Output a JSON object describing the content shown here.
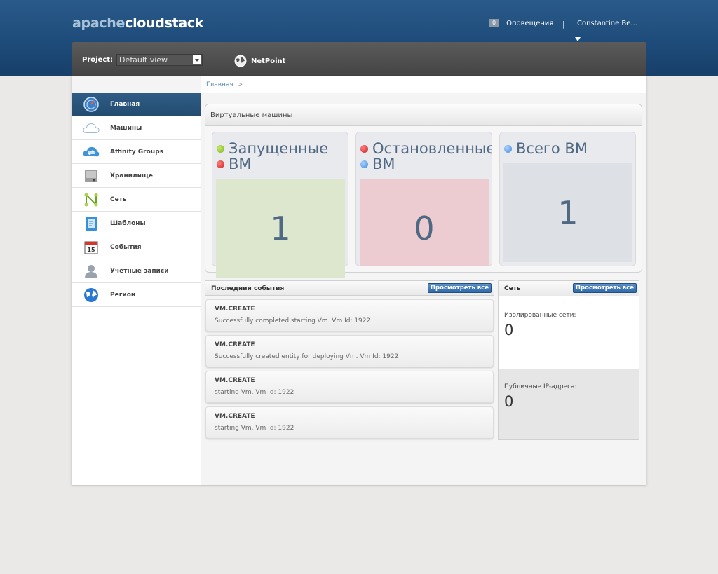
{
  "header": {
    "logo_part1": "apache",
    "logo_part2": "cloudstack",
    "notifications_count": "0",
    "notifications_label": "Оповещения",
    "divider": "|",
    "username": "Constantine Be..."
  },
  "project": {
    "label": "Project:",
    "selected": "Default view",
    "domain_name": "NetPoint"
  },
  "breadcrumb": {
    "home": "Главная",
    "separator": ">"
  },
  "sidebar": {
    "items": [
      {
        "label": "Главная",
        "icon": "dashboard-icon",
        "active": true
      },
      {
        "label": "Машины",
        "icon": "cloud-icon"
      },
      {
        "label": "Affinity Groups",
        "icon": "affinity-icon"
      },
      {
        "label": "Хранилище",
        "icon": "storage-icon"
      },
      {
        "label": "Сеть",
        "icon": "network-icon"
      },
      {
        "label": "Шаблоны",
        "icon": "templates-icon"
      },
      {
        "label": "События",
        "icon": "calendar-icon",
        "icon_text": "15"
      },
      {
        "label": "Учётные записи",
        "icon": "user-icon"
      },
      {
        "label": "Регион",
        "icon": "globe-icon"
      }
    ]
  },
  "vm_panel": {
    "title": "Виртуальные машины",
    "running": {
      "line1": "Запущенные",
      "line2": "ВМ",
      "value": "1"
    },
    "stopped": {
      "line1": "Остановленные",
      "line2": "ВМ",
      "value": "0"
    },
    "total": {
      "line1": "Всего ВМ",
      "value": "1"
    }
  },
  "events_panel": {
    "title": "Последнии события",
    "view_all": "Просмотреть всё",
    "events": [
      {
        "title": "VM.CREATE",
        "desc": "Successfully completed starting Vm. Vm Id: 1922"
      },
      {
        "title": "VM.CREATE",
        "desc": "Successfully created entity for deploying Vm. Vm Id: 1922"
      },
      {
        "title": "VM.CREATE",
        "desc": "starting Vm. Vm Id: 1922"
      },
      {
        "title": "VM.CREATE",
        "desc": "starting Vm. Vm Id: 1922"
      }
    ]
  },
  "network_panel": {
    "title": "Сеть",
    "view_all": "Просмотреть всё",
    "isolated_label": "Изолированные сети:",
    "isolated_value": "0",
    "public_ip_label": "Публичные IP-адреса:",
    "public_ip_value": "0"
  },
  "colors": {
    "header_blue": "#1e4c7a",
    "active_nav": "#2a5479",
    "running_box": "#dce7cd",
    "stopped_box": "#ecccd0",
    "total_box": "#dde1e6",
    "button_blue": "#2f6aa9"
  }
}
